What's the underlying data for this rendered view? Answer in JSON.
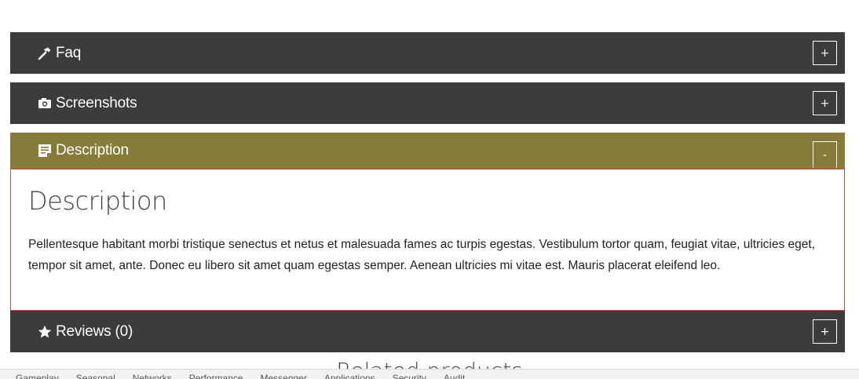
{
  "accordion": {
    "sections": [
      {
        "title": "Faq",
        "toggle": "+",
        "icon": "hammer-icon"
      },
      {
        "title": "Screenshots",
        "toggle": "+",
        "icon": "camera-icon"
      },
      {
        "title": "Description",
        "toggle": "-",
        "icon": "note-icon",
        "expanded": true
      },
      {
        "title": "Reviews (0)",
        "toggle": "+",
        "icon": "star-icon"
      }
    ],
    "panel": {
      "heading": "Description",
      "text": "Pellentesque habitant morbi tristique senectus et netus et malesuada fames ac turpis egestas. Vestibulum tortor quam, feugiat vitae, ultricies eget, tempor sit amet, ante. Donec eu libero sit amet quam egestas semper. Aenean ultricies mi vitae est. Mauris placerat eleifend leo."
    }
  },
  "related": {
    "heading": "Related products"
  },
  "bottom_bar": {
    "items": [
      "Gameplay",
      "Seasonal",
      "Networks",
      "Performance",
      "Messenger",
      "Applications",
      "Security",
      "Audit"
    ]
  },
  "colors": {
    "header_bg": "#3c3c3c",
    "active_bg": "#867b38",
    "panel_border": "#c84a4a"
  }
}
